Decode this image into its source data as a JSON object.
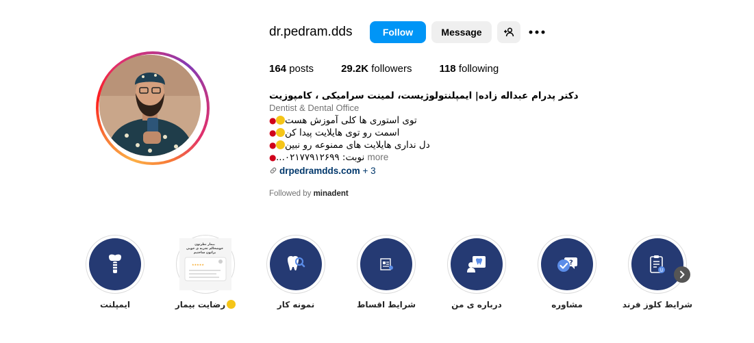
{
  "profile": {
    "username": "dr.pedram.dds",
    "follow_label": "Follow",
    "message_label": "Message"
  },
  "stats": {
    "posts_count": "164",
    "posts_label": "posts",
    "followers_count": "29.2K",
    "followers_label": "followers",
    "following_count": "118",
    "following_label": "following"
  },
  "bio": {
    "name": "دکتر پدرام عبداله زاده| ایمپلنتولوژیست، لمینت سرامیکی ، کامپوزیت",
    "category": "Dentist & Dental Office",
    "line1": "توی استوری ها کلی آموزش هست",
    "line2": "اسمت رو توی هایلایت پیدا کن",
    "line3": "دل نداری هایلایت های ممنوعه رو نبین",
    "line4": "نوبت: ۰۲۱۷۷۹۱۲۶۹۹...",
    "more_label": "more",
    "link_text": "drpedramdds.com",
    "link_extra": "+ 3"
  },
  "followed_by": {
    "prefix": "Followed by",
    "user": "minadent"
  },
  "highlights": [
    {
      "label": "ایمپلنت",
      "icon": "implant-icon"
    },
    {
      "label": "رضایت بیمار",
      "icon": "review-thumbnail"
    },
    {
      "label": "نمونه کار",
      "icon": "tooth-search-icon"
    },
    {
      "label": "شرایط اقساط",
      "icon": "installment-icon"
    },
    {
      "label": "درباره ی من",
      "icon": "about-me-icon"
    },
    {
      "label": "مشاوره",
      "icon": "consult-chat-icon"
    },
    {
      "label": "شرایط کلوز فرند",
      "icon": "clipboard-icon"
    }
  ],
  "review_thumb": {
    "title": "بیمار نظرتون",
    "subtitle": "خوشحالم تجربه ی خوبی",
    "subtitle2": "براتون ساختیم"
  },
  "colors": {
    "follow_blue": "#0095f6",
    "highlight_navy": "#253a73",
    "link_blue": "#00376b",
    "muted_gray": "#737373"
  }
}
